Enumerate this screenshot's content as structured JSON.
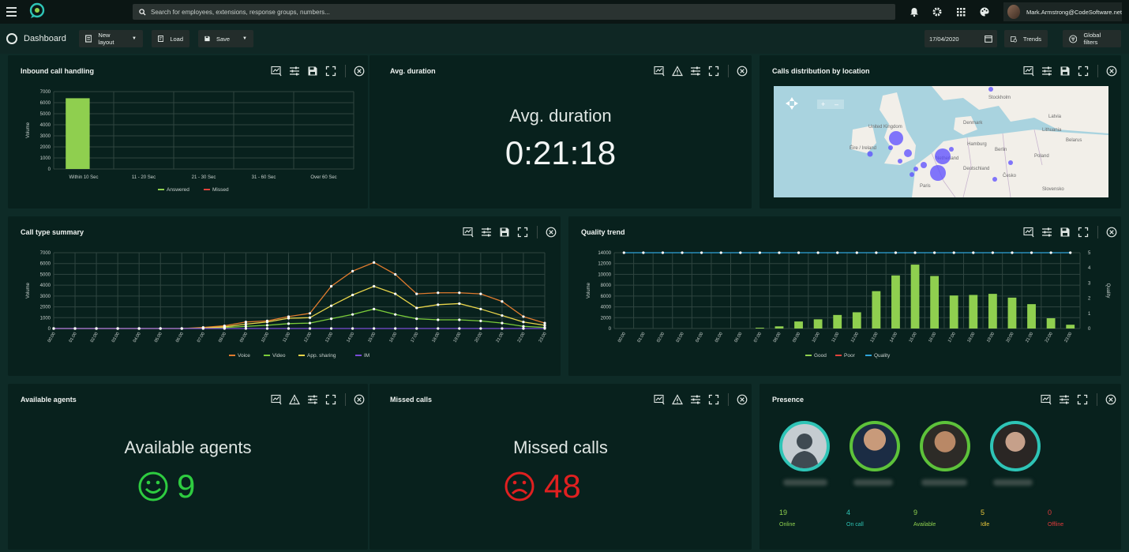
{
  "topbar": {
    "search_placeholder": "Search for employees, extensions, response groups, numbers...",
    "user_email": "Mark.Armstrong@CodeSoftware.net"
  },
  "toolbar": {
    "title": "Dashboard",
    "new_layout": "New layout",
    "load": "Load",
    "save": "Save",
    "date": "17/04/2020",
    "trends": "Trends",
    "global_filters": "Global filters"
  },
  "panels": {
    "inbound": "Inbound call handling",
    "avg_duration": "Avg. duration",
    "calls_distribution": "Calls distribution by location",
    "call_type": "Call type summary",
    "quality_trend": "Quality trend",
    "available_agents": "Available agents",
    "missed_calls": "Missed calls",
    "presence": "Presence"
  },
  "avg_duration": {
    "label": "Avg. duration",
    "value": "0:21:18"
  },
  "available_agents": {
    "label": "Available agents",
    "value": "9"
  },
  "missed_calls": {
    "label": "Missed calls",
    "value": "48"
  },
  "presence": {
    "stats": [
      {
        "value": "19",
        "label": "Online",
        "color": "#8fd14f"
      },
      {
        "value": "4",
        "label": "On call",
        "color": "#2ec4b6"
      },
      {
        "value": "9",
        "label": "Available",
        "color": "#8fd14f"
      },
      {
        "value": "5",
        "label": "Idle",
        "color": "#e7c53a"
      },
      {
        "value": "0",
        "label": "Offline",
        "color": "#e23b3b"
      }
    ]
  },
  "map": {
    "labels": [
      "Stockholm",
      "Latvia",
      "Denmark",
      "Lithuania",
      "United Kingdom",
      "Hamburg",
      "Éire / Ireland",
      "Netherland",
      "Berlin",
      "Deutschland",
      "Paris",
      "Česko",
      "Slovensko",
      "Belarus",
      "Poland"
    ]
  },
  "chart_data": [
    {
      "type": "bar",
      "title": "Inbound call handling",
      "ylabel": "Volume",
      "categories": [
        "Within 10 Sec",
        "11 - 20 Sec",
        "21 - 30 Sec",
        "31 - 60 Sec",
        "Over 60 Sec"
      ],
      "series": [
        {
          "name": "Answered",
          "values": [
            6400,
            0,
            0,
            0,
            0
          ],
          "color": "#8fcf4f"
        },
        {
          "name": "Missed",
          "values": [
            0,
            0,
            0,
            0,
            0
          ],
          "color": "#e0433b"
        }
      ],
      "ylim": [
        0,
        7000
      ],
      "yticks": [
        0,
        1000,
        2000,
        3000,
        4000,
        5000,
        6000,
        7000
      ]
    },
    {
      "type": "line",
      "title": "Call type summary",
      "ylabel": "Volume",
      "categories": [
        "00:00",
        "01:00",
        "02:00",
        "03:00",
        "04:00",
        "05:00",
        "06:00",
        "07:00",
        "08:00",
        "09:00",
        "10:00",
        "11:00",
        "12:00",
        "13:00",
        "14:00",
        "15:00",
        "16:00",
        "17:00",
        "18:00",
        "19:00",
        "20:00",
        "21:00",
        "22:00",
        "23:00"
      ],
      "series": [
        {
          "name": "Voice",
          "color": "#e07b2e",
          "values": [
            0,
            0,
            0,
            0,
            0,
            0,
            0,
            100,
            250,
            600,
            700,
            1100,
            1400,
            3900,
            5300,
            6100,
            5000,
            3200,
            3300,
            3300,
            3200,
            2500,
            1100,
            500
          ]
        },
        {
          "name": "Video",
          "color": "#7acb3a",
          "values": [
            0,
            0,
            0,
            0,
            0,
            0,
            0,
            20,
            80,
            200,
            300,
            450,
            500,
            900,
            1300,
            1800,
            1300,
            900,
            800,
            800,
            700,
            500,
            200,
            100
          ]
        },
        {
          "name": "App. sharing",
          "color": "#e8d44a",
          "values": [
            0,
            0,
            0,
            0,
            0,
            0,
            0,
            50,
            150,
            400,
            600,
            950,
            1000,
            2100,
            3100,
            3900,
            3200,
            1900,
            2200,
            2300,
            1800,
            1200,
            600,
            300
          ]
        },
        {
          "name": "IM",
          "color": "#7a4bd6",
          "values": [
            0,
            0,
            0,
            0,
            0,
            0,
            0,
            0,
            0,
            0,
            0,
            0,
            0,
            0,
            0,
            0,
            0,
            0,
            0,
            0,
            0,
            0,
            0,
            0
          ]
        }
      ],
      "ylim": [
        0,
        7000
      ],
      "yticks": [
        0,
        1000,
        2000,
        3000,
        4000,
        5000,
        6000,
        7000
      ]
    },
    {
      "type": "bar",
      "title": "Quality trend",
      "ylabel": "Volume",
      "y2label": "Quality",
      "categories": [
        "00:00",
        "01:00",
        "02:00",
        "03:00",
        "04:00",
        "05:00",
        "06:00",
        "07:00",
        "08:00",
        "09:00",
        "10:00",
        "11:00",
        "12:00",
        "13:00",
        "14:00",
        "15:00",
        "16:00",
        "17:00",
        "18:00",
        "19:00",
        "20:00",
        "21:00",
        "22:00",
        "23:00"
      ],
      "series": [
        {
          "name": "Good",
          "color": "#8fcf4f",
          "values": [
            0,
            0,
            0,
            0,
            0,
            0,
            0,
            150,
            400,
            1300,
            1700,
            2500,
            3000,
            6900,
            9800,
            11800,
            9700,
            6100,
            6200,
            6400,
            5700,
            4500,
            1900,
            700
          ]
        },
        {
          "name": "Poor",
          "color": "#e0433b",
          "values": [
            0,
            0,
            0,
            0,
            0,
            0,
            0,
            0,
            0,
            0,
            0,
            0,
            0,
            0,
            0,
            0,
            0,
            0,
            0,
            0,
            0,
            0,
            0,
            0
          ]
        },
        {
          "name": "Quality",
          "color": "#2fa3d8",
          "axis": "right",
          "values": [
            5,
            5,
            5,
            5,
            5,
            5,
            5,
            5,
            5,
            5,
            5,
            5,
            5,
            5,
            5,
            5,
            5,
            5,
            5,
            5,
            5,
            5,
            5,
            5
          ]
        }
      ],
      "ylim": [
        0,
        14000
      ],
      "yticks": [
        0,
        2000,
        4000,
        6000,
        8000,
        10000,
        12000,
        14000
      ],
      "y2lim": [
        0,
        5
      ],
      "y2ticks": [
        0,
        1,
        2,
        3,
        4,
        5
      ]
    }
  ]
}
